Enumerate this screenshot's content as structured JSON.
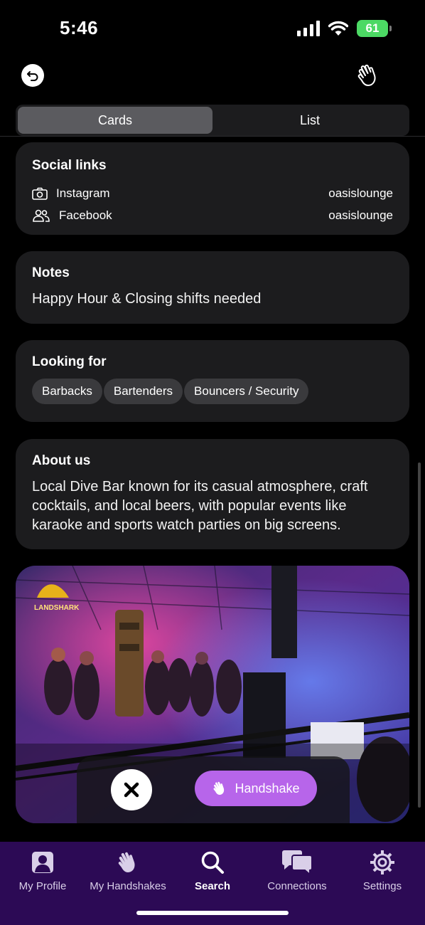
{
  "status": {
    "time": "5:46",
    "battery": "61"
  },
  "segmented": {
    "cards": "Cards",
    "list": "List"
  },
  "social_links": {
    "title": "Social links",
    "items": [
      {
        "icon": "camera-icon",
        "label": "Instagram",
        "value": "oasislounge"
      },
      {
        "icon": "people-icon",
        "label": "Facebook",
        "value": "oasislounge"
      }
    ]
  },
  "notes": {
    "title": "Notes",
    "text": "Happy Hour & Closing shifts needed"
  },
  "looking_for": {
    "title": "Looking for",
    "chips": [
      "Barbacks",
      "Bartenders",
      "Bouncers / Security"
    ]
  },
  "about": {
    "title": "About us",
    "text": "Local Dive Bar known for its casual atmosphere, craft cocktails, and local beers, with popular events like karaoke and sports watch parties on big screens."
  },
  "photo": {
    "sign_text": "LANDSHARK"
  },
  "actions": {
    "handshake": "Handshake"
  },
  "tabs": [
    {
      "label": "My Profile",
      "icon": "profile-icon"
    },
    {
      "label": "My Handshakes",
      "icon": "wave-hand-icon"
    },
    {
      "label": "Search",
      "icon": "search-icon"
    },
    {
      "label": "Connections",
      "icon": "chat-bubbles-icon"
    },
    {
      "label": "Settings",
      "icon": "gear-icon"
    }
  ],
  "colors": {
    "accent": "#b765ea",
    "tabbar": "#2c0a55",
    "card": "#1c1c1e"
  }
}
